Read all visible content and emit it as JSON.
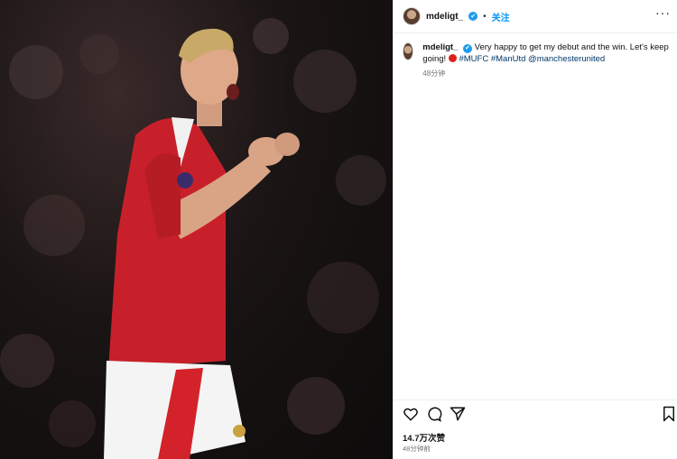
{
  "post": {
    "username": "mdeligt_",
    "verified_badge": "✔",
    "separator": "•",
    "follow_label": "关注",
    "more_label": "···"
  },
  "caption": {
    "username": "mdeligt_",
    "text": "Very happy to get my debut and the win. Let's keep going!",
    "hashtags": [
      "#MUFC",
      "#ManUtd"
    ],
    "mention": "@manchesterunited",
    "time": "48分钟"
  },
  "footer": {
    "likes": "14.7万次赞",
    "time": "48分钟前"
  },
  "icons": [
    "heart-icon",
    "comment-icon",
    "share-icon",
    "bookmark-icon"
  ],
  "colors": {
    "follow": "#0095f6",
    "verified": "#1d9bf0",
    "hashtag": "#00376b",
    "kit_red": "#d3222a"
  }
}
